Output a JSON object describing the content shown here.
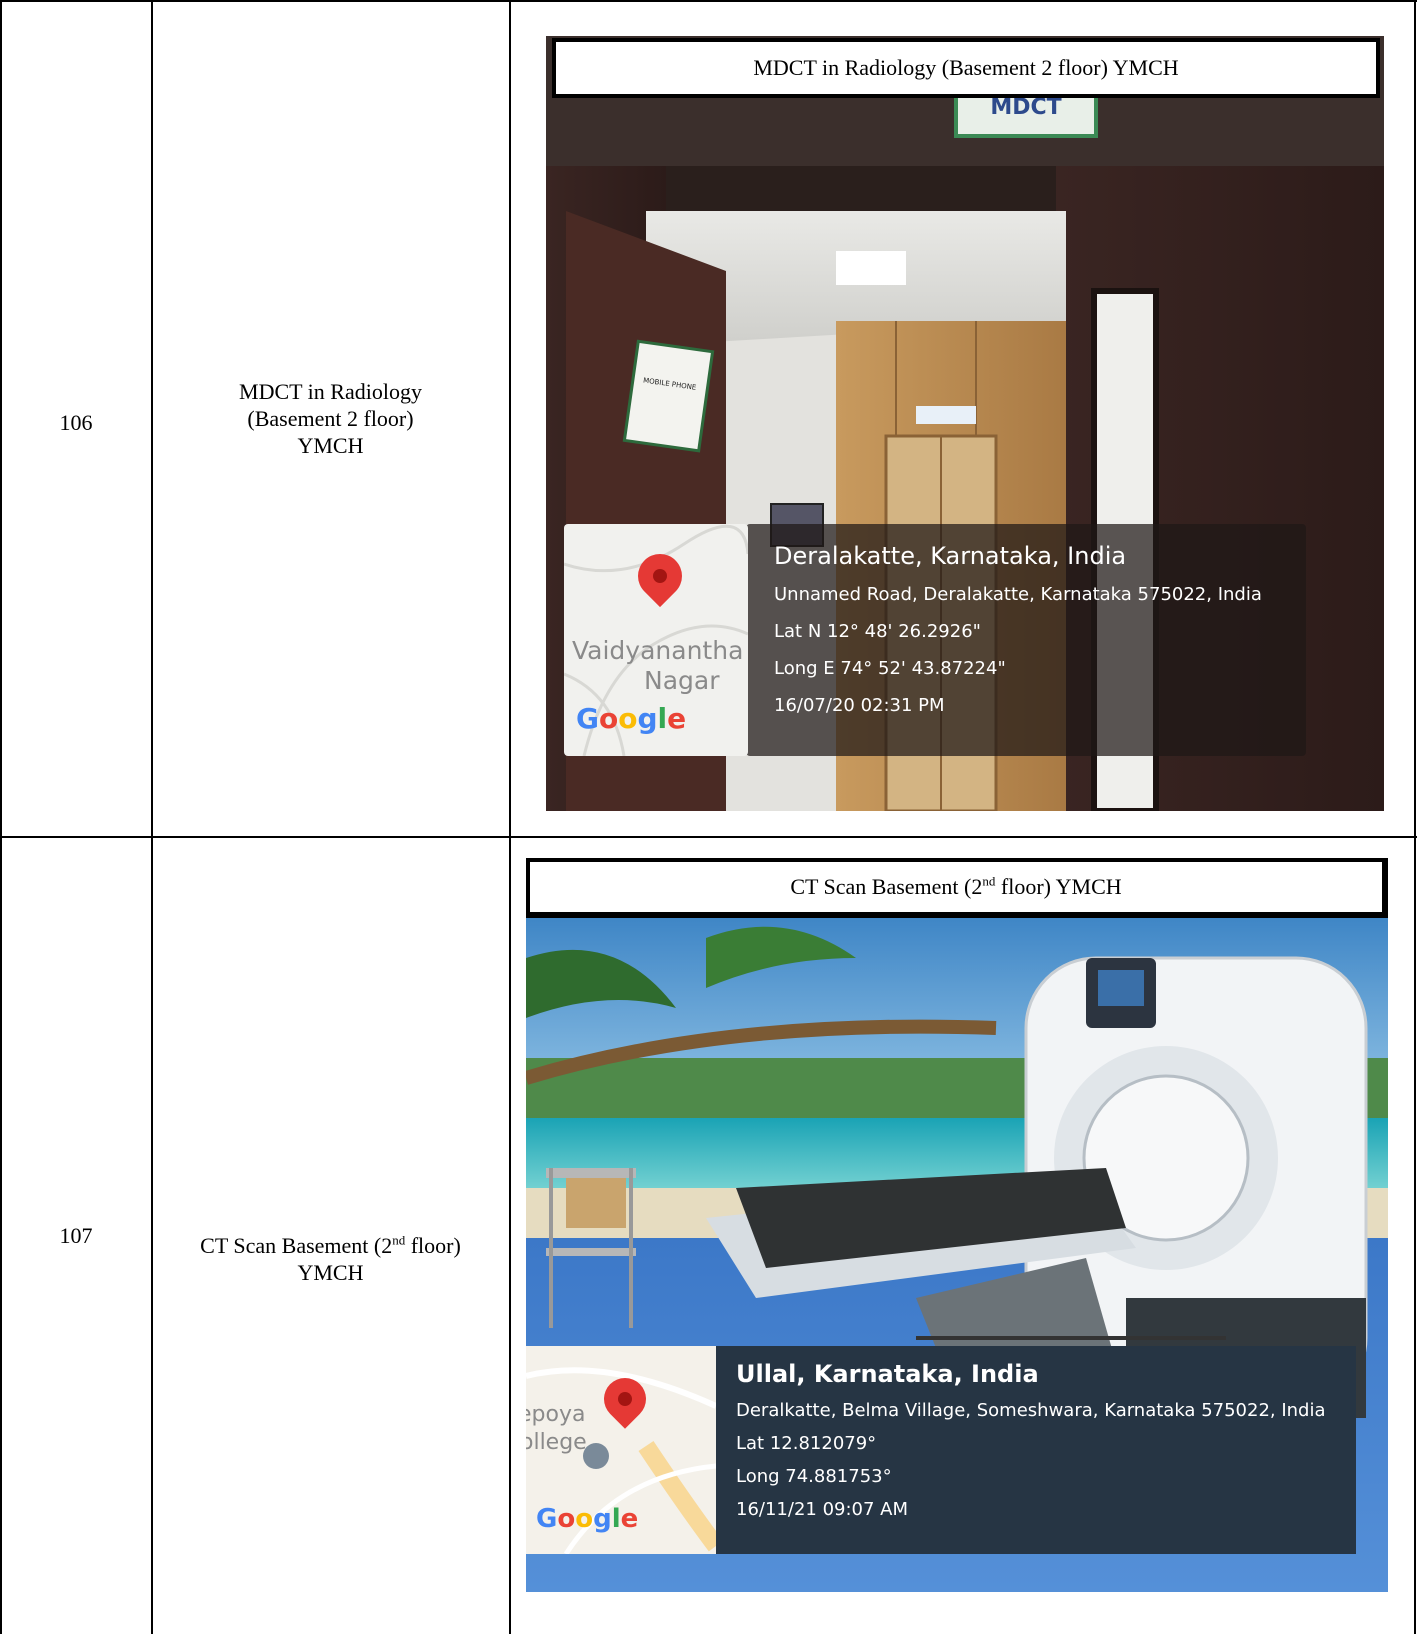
{
  "rows": [
    {
      "number": "106",
      "description_lines": [
        "MDCT in Radiology",
        "(Basement 2 floor)",
        "YMCH"
      ],
      "caption": "MDCT in Radiology (Basement 2 floor) YMCH",
      "geotag": {
        "place": "Deralakatte, Karnataka, India",
        "address": "Unnamed Road, Deralakatte, Karnataka 575022, India",
        "lat": "Lat N 12° 48' 26.2926\"",
        "long": "Long E 74° 52' 43.87224\"",
        "datetime": "16/07/20 02:31 PM",
        "map_label_1": "Vaidyanantha",
        "map_label_2": "Nagar",
        "map_brand": "Google"
      },
      "photo_text": {
        "door_sign": "MDCT",
        "wall_sign": "PLEASE SWITCH OFF YOUR MOBILE PHONE"
      }
    },
    {
      "number": "107",
      "description_pre": "CT Scan Basement (2",
      "description_sup": "nd",
      "description_post": " floor)",
      "description_line2": "YMCH",
      "caption_pre": "CT Scan Basement (2",
      "caption_sup": "nd",
      "caption_post": " floor) YMCH",
      "geotag": {
        "place": "Ullal, Karnataka, India",
        "address": "Deralkatte, Belma Village, Someshwara, Karnataka 575022, India",
        "lat": "Lat 12.812079°",
        "long": "Long 74.881753°",
        "datetime": "16/11/21 09:07 AM",
        "map_label_1": "epoya",
        "map_label_2": "ollege",
        "map_brand": "Google"
      }
    }
  ],
  "colors": {
    "google_blue": "#4285F4",
    "google_red": "#EA4335",
    "google_yellow": "#FBBC05",
    "google_green": "#34A853",
    "pin_red": "#E53935",
    "overlay_dark": "#263544"
  }
}
